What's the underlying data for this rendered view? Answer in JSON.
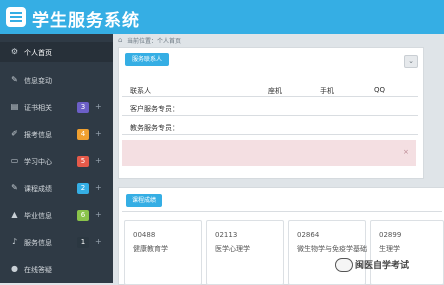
{
  "app": {
    "title": "学生服务系统"
  },
  "sidebar": {
    "items": [
      {
        "label": "个人首页",
        "icon": "dashboard-icon",
        "active": true
      },
      {
        "label": "信息变动",
        "icon": "edit-icon"
      },
      {
        "label": "证书相关",
        "icon": "certificate-icon",
        "badge": "3",
        "badge_color": "#6c5fc7",
        "plus": "+"
      },
      {
        "label": "报考信息",
        "icon": "pencil-icon",
        "badge": "4",
        "badge_color": "#f0a030",
        "plus": "+"
      },
      {
        "label": "学习中心",
        "icon": "laptop-icon",
        "badge": "5",
        "badge_color": "#e55a4a",
        "plus": "+"
      },
      {
        "label": "课程成绩",
        "icon": "edit-icon",
        "badge": "2",
        "badge_color": "#35aee4",
        "plus": "+"
      },
      {
        "label": "毕业信息",
        "icon": "graduation-icon",
        "badge": "6",
        "badge_color": "#8ac34a",
        "plus": "+"
      },
      {
        "label": "服务信息",
        "icon": "bell-icon",
        "badge": "1",
        "badge_color": "#2b3741",
        "plus": "+"
      },
      {
        "label": "在线答疑",
        "icon": "microphone-icon"
      }
    ]
  },
  "breadcrumb": "当前位置：个人首页",
  "contact_panel": {
    "button": "服务联系人",
    "columns": [
      "联系人",
      "座机",
      "手机",
      "QQ"
    ],
    "rows": [
      "客户服务专员：",
      "教务服务专员："
    ],
    "notice_close": "×"
  },
  "courses_panel": {
    "button": "课程成绩",
    "cards": [
      {
        "code": "00488",
        "name": "健康教育学"
      },
      {
        "code": "02113",
        "name": "医学心理学"
      },
      {
        "code": "02864",
        "name": "微生物学与免疫学基础"
      },
      {
        "code": "02899",
        "name": "生理学"
      }
    ]
  },
  "watermark": "闽医自学考试"
}
